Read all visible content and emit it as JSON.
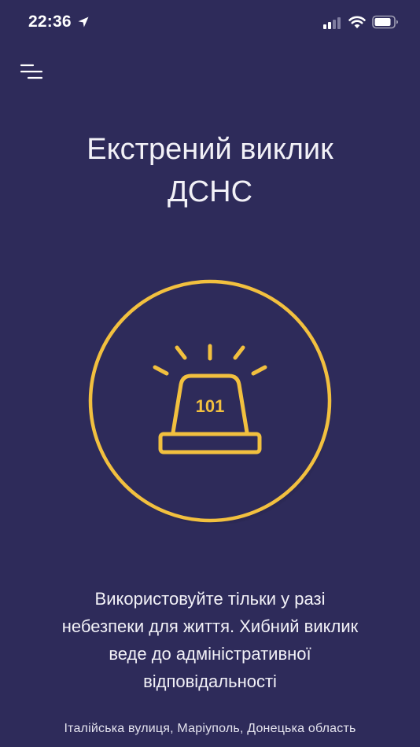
{
  "status_bar": {
    "time": "22:36",
    "icons": [
      "location-arrow-icon",
      "signal-icon",
      "wifi-icon",
      "battery-icon"
    ]
  },
  "header": {
    "menu_icon": "hamburger-menu-icon"
  },
  "title": {
    "line1": "Екстрений виклик",
    "line2": "ДСНС"
  },
  "emergency_button": {
    "number": "101",
    "icon": "siren-icon",
    "accent_color": "#f2c03f"
  },
  "warning": {
    "line1": "Використовуйте тільки у разі",
    "line2": "небезпеки для життя. Хибний виклик",
    "line3": "веде до адміністративної",
    "line4": "відповідальності"
  },
  "location": {
    "address": "Італійська вулиця, Маріуполь, Донецька область"
  },
  "colors": {
    "background": "#2e2b5a",
    "accent": "#f2c03f",
    "text": "#f2f1f7"
  }
}
